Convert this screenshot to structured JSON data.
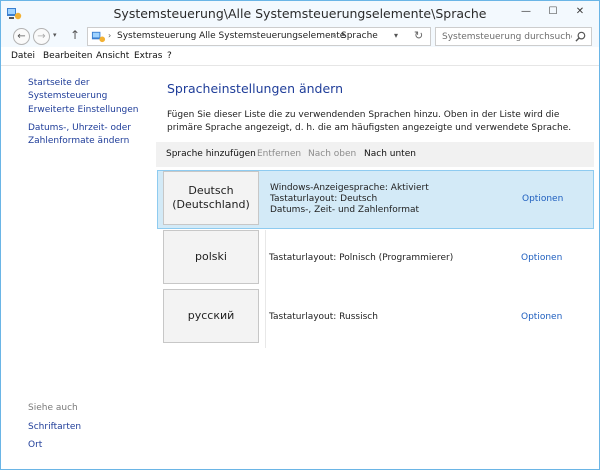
{
  "window": {
    "title": "Systemsteuerung\\Alle Systemsteuerungselemente\\Sprache",
    "controls": {
      "minimize": "—",
      "maximize": "☐",
      "close": "✕"
    }
  },
  "address": {
    "breadcrumbs": [
      "Systemsteuerung",
      "Alle Systemsteuerungselemente",
      "Sprache"
    ],
    "search_placeholder": "Systemsteuerung durchsuchen"
  },
  "menu": [
    "Datei",
    "Bearbeiten",
    "Ansicht",
    "Extras",
    "?"
  ],
  "sidebar": {
    "links": [
      "Startseite der Systemsteuerung",
      "Erweiterte Einstellungen",
      "Datums-, Uhrzeit- oder Zahlenformate ändern"
    ],
    "see_also_title": "Siehe auch",
    "see_also_links": [
      "Schriftarten",
      "Ort"
    ]
  },
  "main": {
    "title": "Spracheinstellungen ändern",
    "description": "Fügen Sie dieser Liste die zu verwendenden Sprachen hinzu. Oben in der Liste wird die primäre Sprache angezeigt, d. h. die am häufigsten angezeigte und verwendete Sprache.",
    "toolbar": {
      "add": "Sprache hinzufügen",
      "remove": "Entfernen",
      "move_up": "Nach oben",
      "move_down": "Nach unten"
    },
    "languages": [
      {
        "name": "Deutsch (Deutschland)",
        "name_line1": "Deutsch",
        "name_line2": "(Deutschland)",
        "details": [
          "Windows-Anzeigesprache: Aktiviert",
          "Tastaturlayout: Deutsch",
          "Datums-, Zeit- und Zahlenformat"
        ],
        "options": "Optionen",
        "selected": true
      },
      {
        "name": "polski",
        "details": [
          "Tastaturlayout: Polnisch (Programmierer)"
        ],
        "options": "Optionen",
        "selected": false
      },
      {
        "name": "русский",
        "details": [
          "Tastaturlayout: Russisch"
        ],
        "options": "Optionen",
        "selected": false
      }
    ]
  },
  "colors": {
    "link": "#1f3d99",
    "selection_bg": "#d3eaf7",
    "selection_border": "#8ecbf0",
    "options_link": "#1f5fbf"
  },
  "icons": [
    "control-panel-icon",
    "back-arrow-icon",
    "forward-arrow-icon",
    "up-arrow-icon",
    "refresh-icon",
    "search-icon"
  ]
}
